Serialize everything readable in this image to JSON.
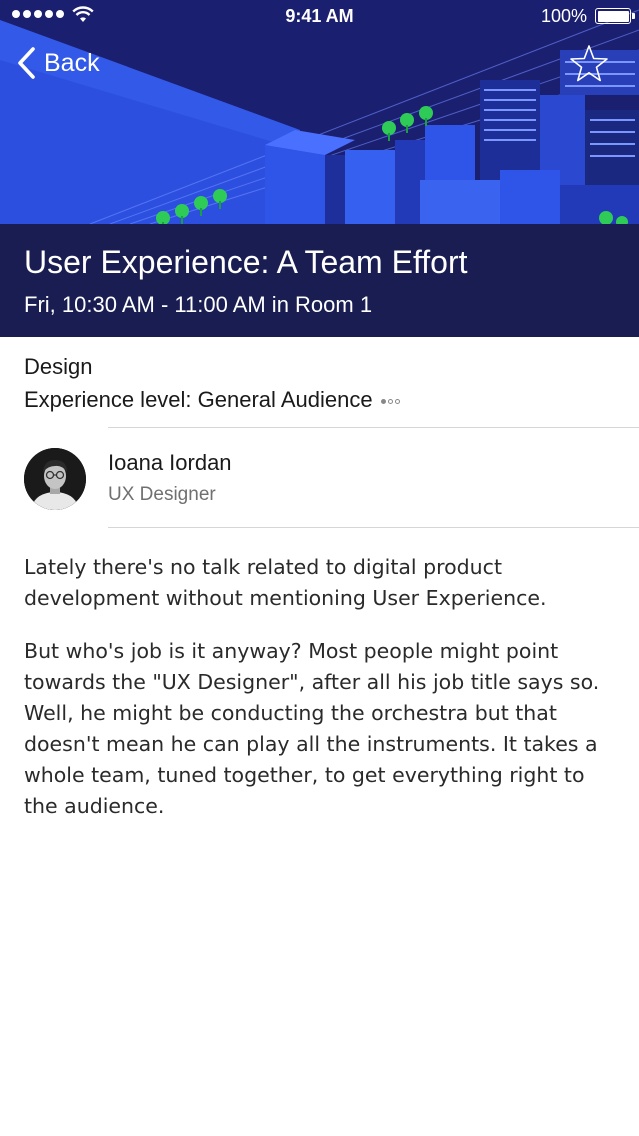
{
  "status_bar": {
    "time": "9:41 AM",
    "battery": "100%"
  },
  "nav": {
    "back_label": "Back",
    "back_icon": "chevron-left-icon",
    "favorite_icon": "star-outline-icon"
  },
  "session": {
    "title": "User Experience: A Team Effort",
    "time": "Fri, 10:30 AM - 11:00 AM in Room 1",
    "track": "Design",
    "level": "Experience level: General Audience",
    "level_value": 1,
    "level_max": 3
  },
  "speaker": {
    "name": "Ioana Iordan",
    "role": "UX Designer"
  },
  "description": {
    "paragraphs": [
      "Lately there's no talk related to digital product development without mentioning User Experience.",
      "But who's job is it anyway? Most people might point towards the \"UX Designer\", after all his job title says so. Well, he might be conducting the orchestra but that doesn't mean he can play all the instruments. It takes a whole team, tuned together, to get everything right to the audience."
    ]
  },
  "colors": {
    "hero_background": "#1a1f6e",
    "hero_accent": "#2f55e8",
    "title_band": "#1a1d52",
    "tree_green": "#2ecc57"
  }
}
